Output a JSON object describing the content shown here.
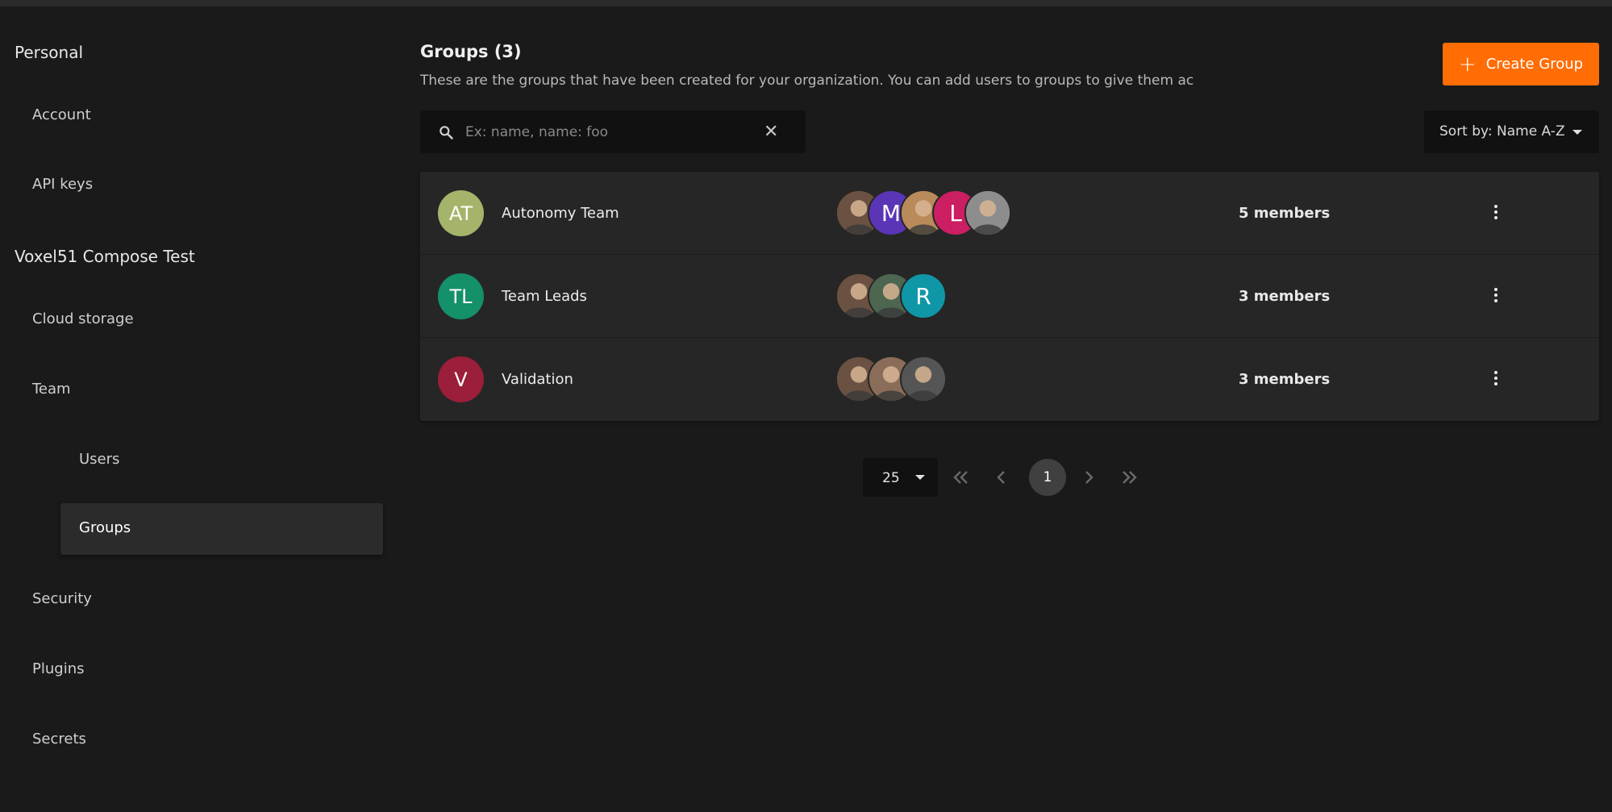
{
  "sidebar": {
    "personal_title": "Personal",
    "personal_items": [
      {
        "label": "Account"
      },
      {
        "label": "API keys"
      }
    ],
    "org_title": "Voxel51 Compose Test",
    "org_items": {
      "cloud_storage": "Cloud storage",
      "team": "Team",
      "users": "Users",
      "groups": "Groups",
      "security": "Security",
      "plugins": "Plugins",
      "secrets": "Secrets"
    }
  },
  "header": {
    "title": "Groups (3)",
    "description": "These are the groups that have been created for your organization. You can add users to groups to give them ac...",
    "create_label": "Create Group"
  },
  "search": {
    "placeholder": "Ex: name, name: foo",
    "value": ""
  },
  "sort": {
    "label": "Sort by: Name A-Z"
  },
  "groups": [
    {
      "initials": "AT",
      "name": "Autonomy Team",
      "color": "#a4b46a",
      "members_label": "5 members",
      "members": [
        {
          "type": "photo",
          "tone": "#6b5142"
        },
        {
          "type": "letter",
          "letter": "M",
          "color": "#5a35b5"
        },
        {
          "type": "photo",
          "tone": "#b98a5a"
        },
        {
          "type": "letter",
          "letter": "L",
          "color": "#cc1e63"
        },
        {
          "type": "photo",
          "tone": "#8d8d8d"
        }
      ]
    },
    {
      "initials": "TL",
      "name": "Team Leads",
      "color": "#14906a",
      "members_label": "3 members",
      "members": [
        {
          "type": "photo",
          "tone": "#6b5142"
        },
        {
          "type": "photo",
          "tone": "#4c6650"
        },
        {
          "type": "letter",
          "letter": "R",
          "color": "#0f97a8"
        }
      ]
    },
    {
      "initials": "V",
      "name": "Validation",
      "color": "#9b1e3a",
      "members_label": "3 members",
      "members": [
        {
          "type": "photo",
          "tone": "#6b5142"
        },
        {
          "type": "photo",
          "tone": "#8a6d58"
        },
        {
          "type": "photo",
          "tone": "#555555"
        }
      ]
    }
  ],
  "pagination": {
    "per_page": "25",
    "current_page": "1"
  },
  "colors": {
    "accent": "#ff6d04",
    "background": "#1a1a1a",
    "panel": "#262626"
  }
}
